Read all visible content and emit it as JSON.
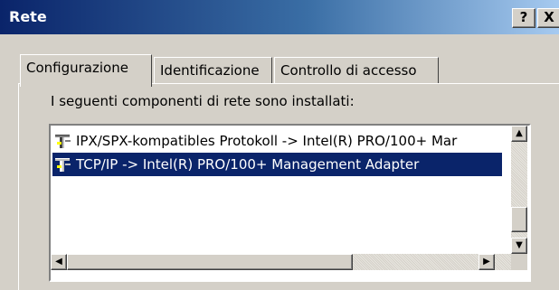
{
  "window": {
    "title": "Rete",
    "help_label": "?",
    "close_label": "X"
  },
  "tabs": [
    {
      "label": "Configurazione",
      "active": true
    },
    {
      "label": "Identificazione",
      "active": false
    },
    {
      "label": "Controllo di accesso",
      "active": false
    }
  ],
  "installed_label": "I seguenti componenti di rete sono installati:",
  "components": [
    {
      "label": "IPX/SPX-kompatibles Protokoll -> Intel(R) PRO/100+ Mar",
      "icon": "network-protocol-icon",
      "selected": false
    },
    {
      "label": "TCP/IP -> Intel(R) PRO/100+ Management Adapter",
      "icon": "network-protocol-icon",
      "selected": true
    }
  ],
  "colors": {
    "titlebar": "#0a246a",
    "selection": "#0a246a",
    "face": "#d4d0c8"
  }
}
